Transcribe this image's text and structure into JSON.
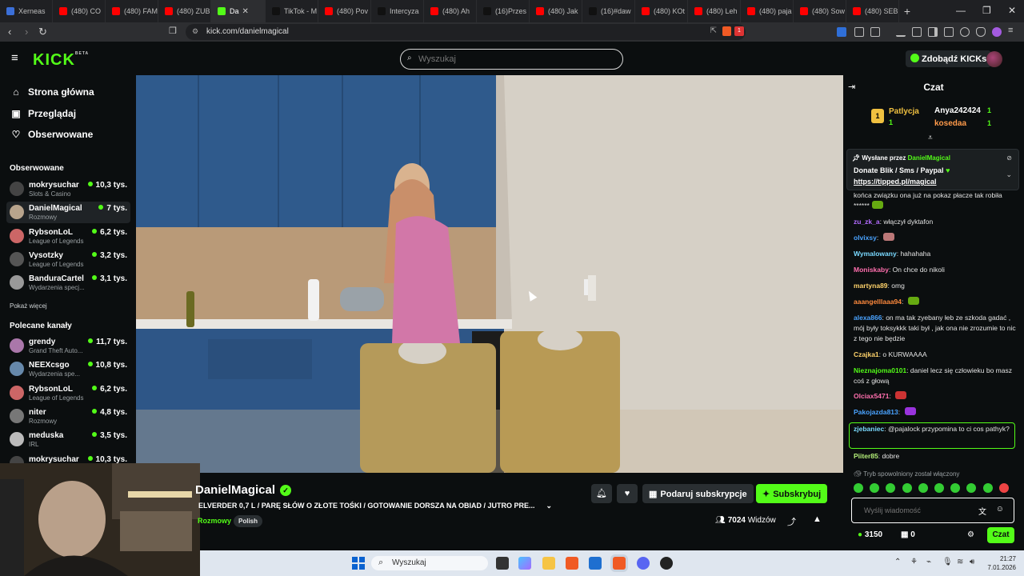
{
  "browser": {
    "tabs": [
      {
        "label": "Xerneas",
        "color": "#3b6fd8"
      },
      {
        "label": "(480) CO",
        "color": "#ff0000"
      },
      {
        "label": "(480) FAM",
        "color": "#ff0000"
      },
      {
        "label": "(480) ZUB",
        "color": "#ff0000"
      },
      {
        "label": "Da",
        "color": "#53fc18",
        "active": true
      },
      {
        "label": "TikTok - M",
        "color": "#111111"
      },
      {
        "label": "(480) Pov",
        "color": "#ff0000"
      },
      {
        "label": "Intercyza",
        "color": "#111111"
      },
      {
        "label": "(480) Ah",
        "color": "#ff0000"
      },
      {
        "label": "(16)Przes",
        "color": "#111111"
      },
      {
        "label": "(480) Jak",
        "color": "#ff0000"
      },
      {
        "label": "(16)#daw",
        "color": "#111111"
      },
      {
        "label": "(480) KOt",
        "color": "#ff0000"
      },
      {
        "label": "(480) Leh",
        "color": "#ff0000"
      },
      {
        "label": "(480) paja",
        "color": "#ff0000"
      },
      {
        "label": "(480) Sow",
        "color": "#ff0000"
      },
      {
        "label": "(480) SEB",
        "color": "#ff0000"
      }
    ],
    "new_tab": "+",
    "close_tab": "✕",
    "minimize": "—",
    "maximize": "❐",
    "close_window": "✕",
    "url": "kick.com/danielmagical",
    "ext_badge": "1"
  },
  "header": {
    "logo": "KICK",
    "logo_sup": "BETA",
    "search_placeholder": "Wyszukaj",
    "get_kicks": "Zdobądź KICKs"
  },
  "sidebar": {
    "nav": [
      {
        "label": "Strona główna",
        "icon": "⌂"
      },
      {
        "label": "Przeglądaj",
        "icon": "▣"
      },
      {
        "label": "Obserwowane",
        "icon": "♡"
      }
    ],
    "followed_title": "Obserwowane",
    "followed": [
      {
        "name": "mokrysuchar",
        "category": "Slots & Casino",
        "viewers": "10,3 tys.",
        "color": "#444"
      },
      {
        "name": "DanielMagical",
        "category": "Rozmowy",
        "viewers": "7 tys.",
        "color": "#b8a48c",
        "selected": true
      },
      {
        "name": "RybsonLoL",
        "category": "League of Legends",
        "viewers": "6,2 tys.",
        "color": "#c66"
      },
      {
        "name": "Vysotzky",
        "category": "League of Legends",
        "viewers": "3,2 tys.",
        "color": "#555"
      },
      {
        "name": "BanduraCartel",
        "category": "Wydarzenia specj...",
        "viewers": "3,1 tys.",
        "color": "#999"
      }
    ],
    "show_more": "Pokaż więcej",
    "recommended_title": "Polecane kanały",
    "recommended": [
      {
        "name": "grendy",
        "category": "Grand Theft Auto...",
        "viewers": "11,7 tys.",
        "color": "#a7a"
      },
      {
        "name": "NEEXcsgo",
        "category": "Wydarzenia spe...",
        "viewers": "10,8 tys.",
        "color": "#68a"
      },
      {
        "name": "RybsonLoL",
        "category": "League of Legends",
        "viewers": "6,2 tys.",
        "color": "#c66"
      },
      {
        "name": "niter",
        "category": "Rozmowy",
        "viewers": "4,8 tys.",
        "color": "#777"
      },
      {
        "name": "meduska",
        "category": "IRL",
        "viewers": "3,5 tys.",
        "color": "#bbb"
      },
      {
        "name": "mokrysuchar",
        "category": "",
        "viewers": "10,3 tys.",
        "color": "#444"
      }
    ]
  },
  "stream": {
    "streamer": "DanielMagical",
    "title": "ELVERDER 0,7 L / PARĘ SŁÓW O ZŁOTE TOŚKI / GOTOWANIE DORSZA NA OBIAD / JUTRO PRE...",
    "category": "Rozmowy",
    "tag": "Polish",
    "gift_sub": "Podaruj subskrypcje",
    "subscribe": "Subskrybuj",
    "viewers": "7024",
    "viewers_label": "Widzów"
  },
  "chat": {
    "title": "Czat",
    "leaderboard": [
      {
        "rank": "1",
        "name": "Patlycja",
        "count": "1",
        "color": "#f0c040"
      },
      {
        "name": "Anya242424",
        "count": "1",
        "color": "#ffffff"
      },
      {
        "name": "kosedaa",
        "count": "1",
        "color": "#ff9a4a"
      }
    ],
    "pinned_by": "Wysłane przez",
    "pinned_user": "DanielMagical",
    "pinned_text": "Donate Blik / Sms / Paypal",
    "pinned_link": "https://tipped.pl/magical",
    "messages": [
      {
        "user": "",
        "text": "końca związku ona już na pokaz płacze tak robiła ******",
        "color": "#e3e3e3"
      },
      {
        "user": "zu_zk_a",
        "text": "włączył dyktafon",
        "color": "#b36bff"
      },
      {
        "user": "olvixsy",
        "text": "",
        "color": "#4aa3ff"
      },
      {
        "user": "Wymalowany",
        "text": "hahahaha",
        "color": "#7ad9ff"
      },
      {
        "user": "Moniskaby",
        "text": "On chce do nikoli",
        "color": "#ff6fae"
      },
      {
        "user": "martyna89",
        "text": "omg",
        "color": "#ffd36b"
      },
      {
        "user": "aaangelllaaa94",
        "text": "",
        "color": "#ff8a3d"
      },
      {
        "user": "alexa866",
        "text": "on ma tak zyebany łeb ze szkoda gadać , mój były toksykkk taki był , jak ona nie zrozumie to nic z tego nie będzie",
        "color": "#4aa3ff"
      },
      {
        "user": "Czajka1",
        "text": "o KURWAAAA",
        "color": "#ffd36b"
      },
      {
        "user": "Nieznajoma0101",
        "text": "daniel lecz się człowieku bo masz coś z głową",
        "color": "#53fc18"
      },
      {
        "user": "Olciax5471",
        "text": "",
        "color": "#ff6fae"
      },
      {
        "user": "Pakojazda813",
        "text": "",
        "color": "#4aa3ff"
      },
      {
        "user": "zjebaniec",
        "text": "@pajalock przypomina to ci cos pathyk?",
        "color": "#7ad9ff"
      },
      {
        "user": "Piiter85",
        "text": "dobre",
        "color": "#b5f07a"
      }
    ],
    "slow_mode": "Tryb spowolniony został włączony",
    "input_placeholder": "Wyślij wiadomość",
    "points": "3150",
    "gifts": "0",
    "send": "Czat"
  },
  "taskbar": {
    "search": "Wyszukaj",
    "time": "21:27",
    "date": "7.01.2026"
  },
  "colors": {
    "accent": "#53fc18",
    "bg": "#0b0e0f"
  }
}
